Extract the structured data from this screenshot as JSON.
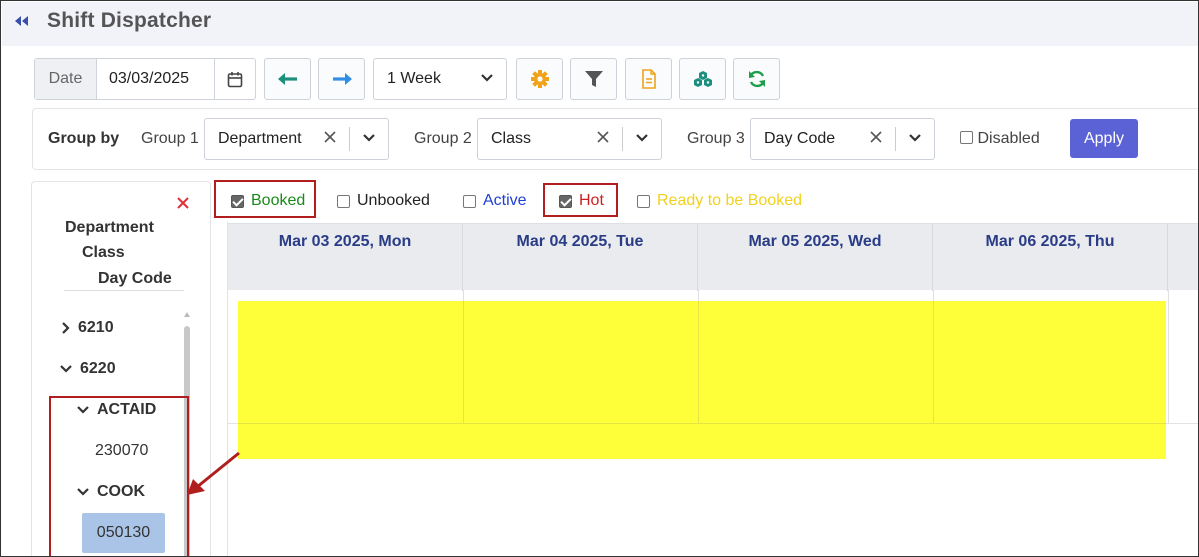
{
  "header": {
    "title": "Shift Dispatcher"
  },
  "toolbar": {
    "date_label": "Date",
    "date_value": "03/03/2025",
    "period": "1 Week"
  },
  "groupby": {
    "label": "Group by",
    "group1_label": "Group 1",
    "group1_value": "Department",
    "group2_label": "Group 2",
    "group2_value": "Class",
    "group3_label": "Group 3",
    "group3_value": "Day Code",
    "disabled_label": "Disabled",
    "apply_label": "Apply"
  },
  "tree": {
    "headers": [
      "Department",
      "Class",
      "Day Code"
    ],
    "items": [
      {
        "label": "6210",
        "expanded": false
      },
      {
        "label": "6220",
        "expanded": true
      },
      {
        "label": "ACTAID",
        "expanded": true
      },
      {
        "label": "230070"
      },
      {
        "label": "COOK",
        "expanded": true
      },
      {
        "label": "050130",
        "selected": true
      }
    ]
  },
  "filters": [
    {
      "label": "Booked",
      "checked": true,
      "color": "#1a8a1a"
    },
    {
      "label": "Unbooked",
      "checked": false,
      "color": "#222222"
    },
    {
      "label": "Active",
      "checked": false,
      "color": "#1f3fd6"
    },
    {
      "label": "Hot",
      "checked": true,
      "color": "#cc1f1f"
    },
    {
      "label": "Ready to be Booked",
      "checked": false,
      "color": "#f0d21e"
    }
  ],
  "calendar": {
    "columns": [
      "Mar 03 2025, Mon",
      "Mar 04 2025, Tue",
      "Mar 05 2025, Wed",
      "Mar 06 2025, Thu"
    ]
  },
  "colors": {
    "accent": "#5b62d6",
    "header_text": "#2a3c86",
    "highlight": "#ffff3a",
    "annotation": "#b01e1e"
  }
}
